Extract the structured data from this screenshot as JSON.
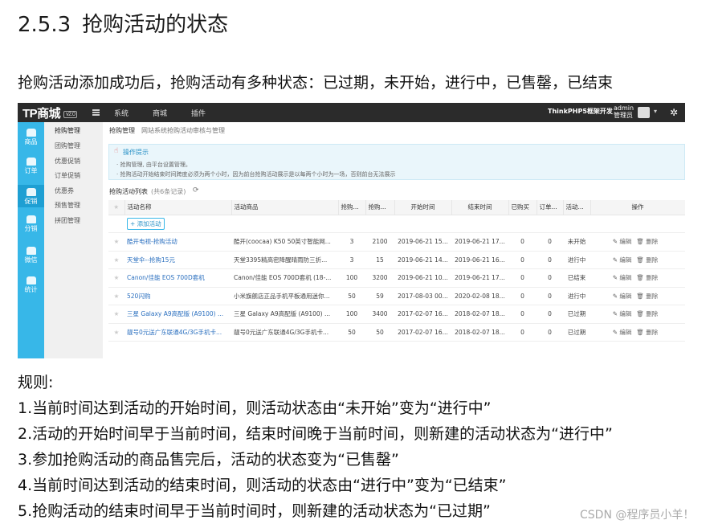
{
  "doc": {
    "section_num": "2.5.3",
    "section_title": "抢购活动的状态",
    "intro": "抢购活动添加成功后，抢购活动有多种状态：已过期，未开始，进行中，已售罄，已结束"
  },
  "topbar": {
    "logo": "TP商城",
    "version": "v2.0",
    "nav": [
      "系统",
      "商城",
      "插件"
    ],
    "brand_link": "ThinkPHP5框架开发",
    "admin_name": "admin",
    "admin_role": "管理员"
  },
  "sidebar_main": [
    {
      "label": "商品",
      "icon": "goods-icon"
    },
    {
      "label": "订单",
      "icon": "order-icon"
    },
    {
      "label": "促销",
      "icon": "promotion-icon"
    },
    {
      "label": "分销",
      "icon": "distribution-icon"
    },
    {
      "label": "微信",
      "icon": "wechat-icon"
    },
    {
      "label": "统计",
      "icon": "statistics-icon"
    }
  ],
  "sidebar_sub": [
    "抢购管理",
    "团购管理",
    "优惠促销",
    "订单促销",
    "优惠券",
    "预售管理",
    "拼团管理"
  ],
  "breadcrumb": {
    "title": "抢购管理",
    "sub": "网站系统抢购活动审核与管理"
  },
  "tips": {
    "title": "操作提示",
    "lines": [
      "· 抢购管理, 由平台设置管理。",
      "· 抢购活动开始结束时间跨度必须为两个小时，因为前台抢购活动展示是以每两个小时为一场，否则前台无法展示"
    ]
  },
  "list": {
    "title": "抢购活动列表",
    "count": "(共6条记录)",
    "add_button": "+ 添加活动",
    "headers": [
      "活动名称",
      "活动商品",
      "抢购...",
      "抢购...",
      "开始时间",
      "结束时间",
      "已购买",
      "订单...",
      "活动...",
      "操作"
    ],
    "edit_label": "编辑",
    "delete_label": "删除",
    "rows": [
      {
        "name": "酷开电视-抢购活动",
        "goods": "酷开(coocaa) K50 50英寸智能网...",
        "price": "3",
        "qty": "2100",
        "start": "2019-06-21 15...",
        "end": "2019-06-21 17...",
        "bought": "0",
        "orders": "0",
        "status": "未开始"
      },
      {
        "name": "天堂伞--抢购15元",
        "goods": "天堂3395精高密降醒晴雨防三折...",
        "price": "3",
        "qty": "15",
        "start": "2019-06-21 14...",
        "end": "2019-06-21 16...",
        "bought": "0",
        "orders": "0",
        "status": "进行中"
      },
      {
        "name": "Canon/佳能 EOS 700D套机",
        "goods": "Canon/佳能 EOS 700D套机 (18-...",
        "price": "100",
        "qty": "3200",
        "start": "2019-06-21 10...",
        "end": "2019-06-21 17...",
        "bought": "0",
        "orders": "0",
        "status": "已结束"
      },
      {
        "name": "520闪购",
        "goods": "小米旗舰店正品手机平板通用迷你...",
        "price": "50",
        "qty": "59",
        "start": "2017-08-03 00...",
        "end": "2020-02-08 18...",
        "bought": "0",
        "orders": "0",
        "status": "进行中"
      },
      {
        "name": "三星 Galaxy A9高配版 (A9100) ...",
        "goods": "三星 Galaxy A9高配版 (A9100) ...",
        "price": "100",
        "qty": "3400",
        "start": "2017-02-07 16...",
        "end": "2018-02-07 18...",
        "bought": "0",
        "orders": "0",
        "status": "已过期"
      },
      {
        "name": "靓号0元送广东联通4G/3G手机卡...",
        "goods": "靓号0元送广东联通4G/3G手机卡...",
        "price": "50",
        "qty": "50",
        "start": "2017-02-07 16...",
        "end": "2018-02-07 18...",
        "bought": "0",
        "orders": "0",
        "status": "已过期"
      }
    ]
  },
  "rules": {
    "heading": "规则:",
    "items": [
      "1.当前时间达到活动的开始时间，则活动状态由“未开始”变为“进行中”",
      "2.活动的开始时间早于当前时间，结束时间晚于当前时间，则新建的活动状态为“进行中”",
      "3.参加抢购活动的商品售完后，活动的状态变为“已售罄”",
      "4.当前时间达到活动的结束时间，则活动的状态由“进行中”变为“已结束”",
      "5.抢购活动的结束时间早于当前时间时，则新建的活动状态为“已过期”"
    ]
  },
  "watermark": "CSDN @程序员小羊！"
}
